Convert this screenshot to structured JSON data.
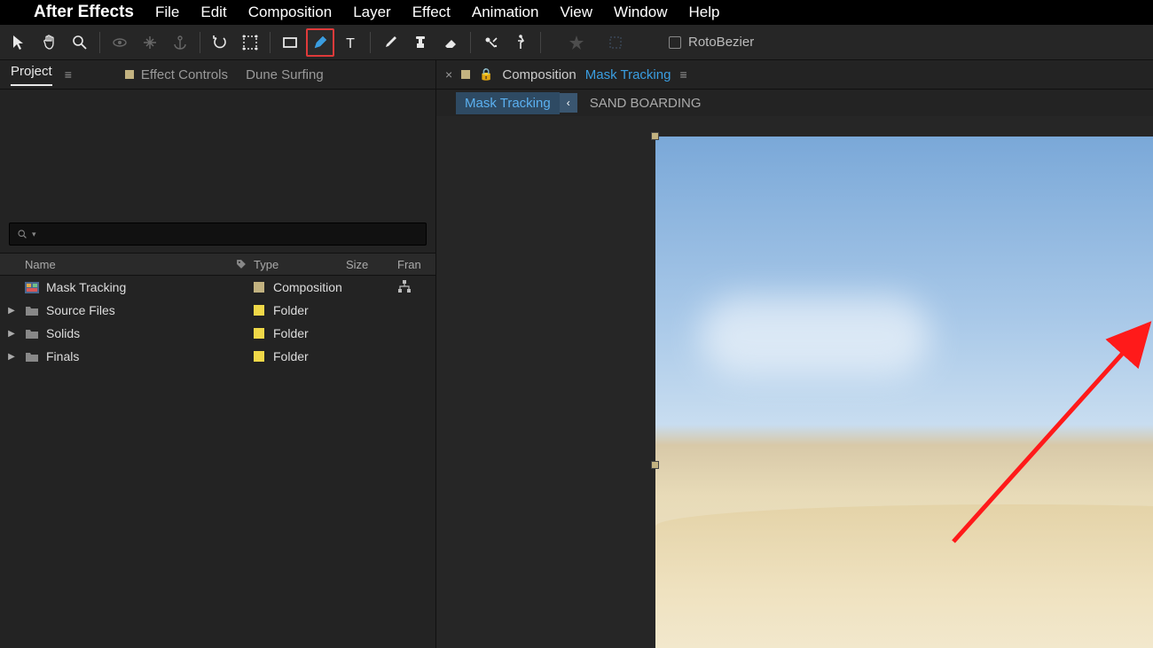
{
  "menubar": {
    "app_name": "After Effects",
    "items": [
      "File",
      "Edit",
      "Composition",
      "Layer",
      "Effect",
      "Animation",
      "View",
      "Window",
      "Help"
    ]
  },
  "toolbar": {
    "rotobezier_label": "RotoBezier"
  },
  "project_panel": {
    "tab_label": "Project",
    "effect_controls_label": "Effect Controls",
    "effect_controls_layer": "Dune Surfing",
    "headers": {
      "name": "Name",
      "type": "Type",
      "size": "Size",
      "frame": "Fran"
    },
    "items": [
      {
        "name": "Mask Tracking",
        "type": "Composition",
        "chip": "#c2b280",
        "expandable": false,
        "icon": "comp",
        "flowchart": true
      },
      {
        "name": "Source Files",
        "type": "Folder",
        "chip": "#f0d848",
        "expandable": true,
        "icon": "folder"
      },
      {
        "name": "Solids",
        "type": "Folder",
        "chip": "#f0d848",
        "expandable": true,
        "icon": "folder"
      },
      {
        "name": "Finals",
        "type": "Folder",
        "chip": "#f0d848",
        "expandable": true,
        "icon": "folder"
      }
    ]
  },
  "composition_panel": {
    "label": "Composition",
    "active_comp": "Mask Tracking",
    "breadcrumb": [
      {
        "label": "Mask Tracking",
        "active": true
      },
      {
        "label": "SAND BOARDING",
        "active": false
      }
    ]
  }
}
